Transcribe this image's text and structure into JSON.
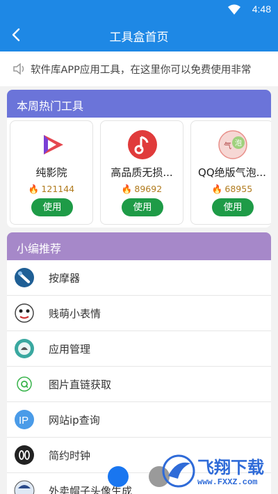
{
  "status": {
    "time": "4:48",
    "wifi_icon": "wifi-icon"
  },
  "appbar": {
    "title": "工具盒首页",
    "back_icon": "back-arrow-icon"
  },
  "notice": {
    "text": "软件库APP应用工具，在这里你可以免费使用非常",
    "icon": "speaker-icon"
  },
  "hot": {
    "title": "本周热门工具",
    "cards": [
      {
        "name": "纯影院",
        "count": "121144",
        "button": "使用",
        "icon": "play-triangle-icon"
      },
      {
        "name": "高品质无损...",
        "count": "89692",
        "button": "使用",
        "icon": "music-note-icon"
      },
      {
        "name": "QQ绝版气泡...",
        "count": "68955",
        "button": "使用",
        "icon": "bubble-icon"
      }
    ]
  },
  "recommend": {
    "title": "小编推荐",
    "items": [
      {
        "label": "按摩器",
        "icon": "massager-icon"
      },
      {
        "label": "贱萌小表情",
        "icon": "emoji-face-icon"
      },
      {
        "label": "应用管理",
        "icon": "android-icon"
      },
      {
        "label": "图片直链获取",
        "icon": "link-icon"
      },
      {
        "label": "网站ip查询",
        "icon": "ip-icon"
      },
      {
        "label": "简约时钟",
        "icon": "clock-icon"
      },
      {
        "label": "外卖帽子头像生成",
        "icon": "avatar-hat-icon"
      }
    ]
  },
  "watermark": {
    "brand": "飞翔下载",
    "url": "www.FXXZ.com"
  },
  "colors": {
    "primary": "#1e88e5",
    "hot_header": "#6b74d9",
    "rec_header": "#a688c9",
    "use_button": "#1e9b47"
  }
}
